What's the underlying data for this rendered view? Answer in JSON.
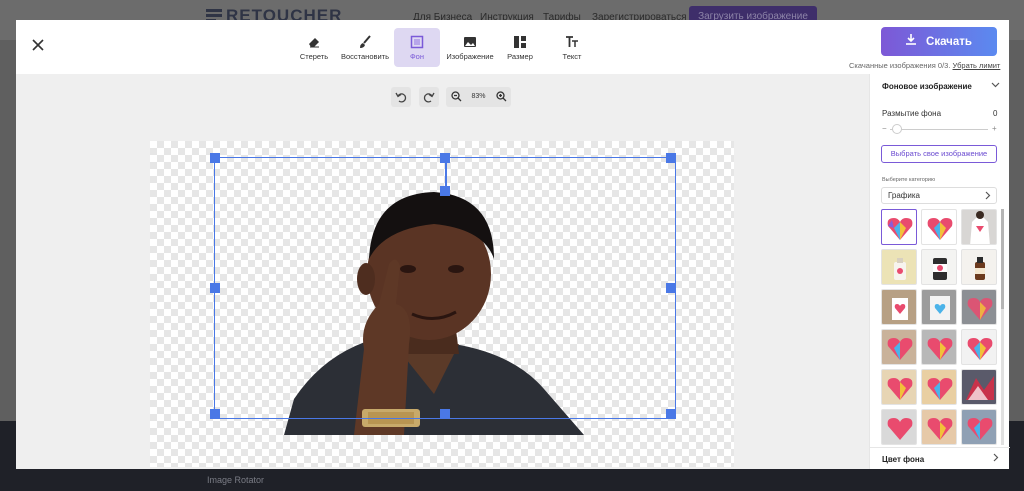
{
  "background_page": {
    "logo": "RETOUCHER",
    "nav": [
      "Для Бизнеса",
      "Инструкция",
      "Тарифы",
      "Зарегистрироваться"
    ],
    "upload_button": "Загрузить изображение",
    "footer_text": "Image Rotator"
  },
  "toolbar": {
    "close_icon": "close-icon",
    "tools": [
      {
        "label": "Стереть",
        "icon": "eraser-icon"
      },
      {
        "label": "Восстановить",
        "icon": "brush-icon"
      },
      {
        "label": "Фон",
        "icon": "background-icon",
        "active": true
      },
      {
        "label": "Изображение",
        "icon": "image-icon"
      },
      {
        "label": "Размер",
        "icon": "layout-icon"
      },
      {
        "label": "Текст",
        "icon": "text-icon"
      }
    ],
    "download_label": "Скачать",
    "downloads_note": "Скачанные изображения 0/3.",
    "remove_limit": "Убрать лимит"
  },
  "zoom": {
    "value": "83%"
  },
  "panel": {
    "section_title": "Фоновое изображение",
    "blur_label": "Размытие фона",
    "blur_value": "0",
    "slider_min": "−",
    "slider_plus": "+",
    "choose_button": "Выбрать свое изображение",
    "category_label": "Выберите категорию",
    "category_value": "Графика",
    "footer_section": "Цвет фона"
  },
  "colors": {
    "accent": "#7a5ad8",
    "selection": "#4a78e6",
    "download_gradient": [
      "#7d58d6",
      "#5b8af0"
    ]
  }
}
